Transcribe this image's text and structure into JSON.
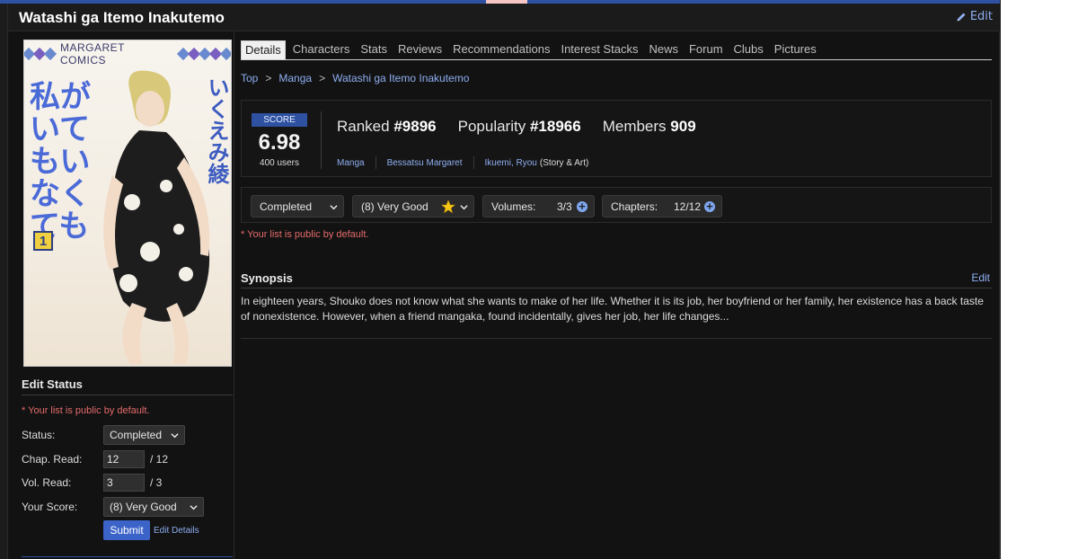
{
  "page": {
    "title": "Watashi ga Itemo Inakutemo",
    "edit_label": "Edit"
  },
  "cover": {
    "brand": "MARGARET COMICS",
    "jp_title": "私がいてもいなくても",
    "jp_author": "いくえみ綾",
    "volume_number": "1"
  },
  "tabs": [
    "Details",
    "Characters",
    "Stats",
    "Reviews",
    "Recommendations",
    "Interest Stacks",
    "News",
    "Forum",
    "Clubs",
    "Pictures"
  ],
  "breadcrumb": {
    "items": [
      "Top",
      "Manga",
      "Watashi ga Itemo Inakutemo"
    ],
    "separator": ">"
  },
  "score": {
    "label": "SCORE",
    "value": "6.98",
    "users": "400 users",
    "ranked_label": "Ranked",
    "ranked_value": "#9896",
    "popularity_label": "Popularity",
    "popularity_value": "#18966",
    "members_label": "Members",
    "members_value": "909",
    "type": "Manga",
    "magazine": "Bessatsu Margaret",
    "author": "Ikuemi, Ryou",
    "author_role": "(Story & Art)"
  },
  "status_box": {
    "status_value": "Completed",
    "score_value": "(8) Very Good",
    "volumes_label": "Volumes:",
    "volumes_value": "3/3",
    "chapters_label": "Chapters:",
    "chapters_value": "12/12",
    "public_note": "* Your list is public by default."
  },
  "synopsis": {
    "title": "Synopsis",
    "edit_label": "Edit",
    "text": "In eighteen years, Shouko does not know what she wants to make of her life. Whether it is its job, her boyfriend or her family, her existence has a back taste of nonexistence. However, when a friend mangaka, found incidentally, gives her job, her life changes..."
  },
  "edit_status": {
    "heading": "Edit Status",
    "public_note": "* Your list is public by default.",
    "status_label": "Status:",
    "status_value": "Completed",
    "chap_label": "Chap. Read:",
    "chap_value": "12",
    "chap_total": "/ 12",
    "vol_label": "Vol. Read:",
    "vol_value": "3",
    "vol_total": "/ 3",
    "score_label": "Your Score:",
    "score_value": "(8) Very Good",
    "submit_label": "Submit",
    "edit_details_label": "Edit Details"
  },
  "colors": {
    "accent": "#2e51a2",
    "link": "#8eaef0",
    "warning": "#e56b6b",
    "background": "#121212"
  },
  "icons": {
    "edit": "pencil-icon",
    "dropdown": "chevron-down-icon",
    "score": "star-icon",
    "increment": "plus-circle-icon"
  }
}
